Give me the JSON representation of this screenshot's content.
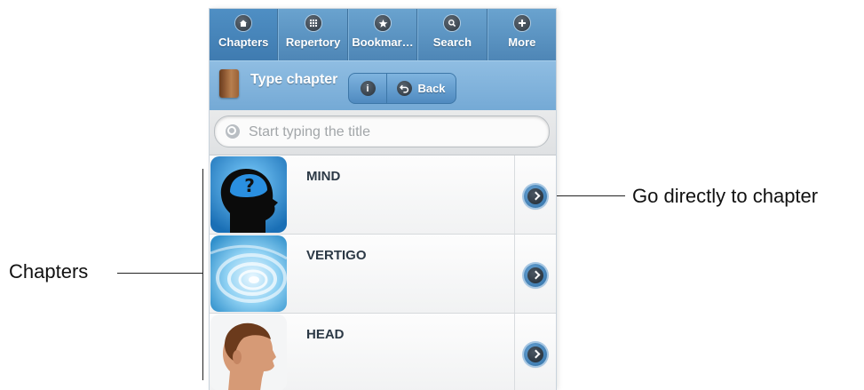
{
  "annotations": {
    "chapters_label": "Chapters",
    "go_directly_label": "Go directly to chapter"
  },
  "tabs": [
    {
      "label": "Chapters",
      "icon": "home-icon",
      "active": true
    },
    {
      "label": "Repertory",
      "icon": "grid-icon",
      "active": false
    },
    {
      "label": "Bookmar…",
      "icon": "star-icon",
      "active": false
    },
    {
      "label": "Search",
      "icon": "search-icon",
      "active": false
    },
    {
      "label": "More",
      "icon": "plus-icon",
      "active": false
    }
  ],
  "header": {
    "title": "Type chapter",
    "info_icon": "info-icon",
    "back_label": "Back"
  },
  "search": {
    "placeholder": "Start typing the title"
  },
  "chapters": [
    {
      "title": "MIND",
      "thumb": "mind-head-question"
    },
    {
      "title": "VERTIGO",
      "thumb": "vertigo-swirl"
    },
    {
      "title": "HEAD",
      "thumb": "head-profile"
    }
  ],
  "colors": {
    "tabbar": "#4e86b6",
    "header": "#74a9d5",
    "chevron_button": "#2e6fa6",
    "row_text": "#2c3946"
  }
}
